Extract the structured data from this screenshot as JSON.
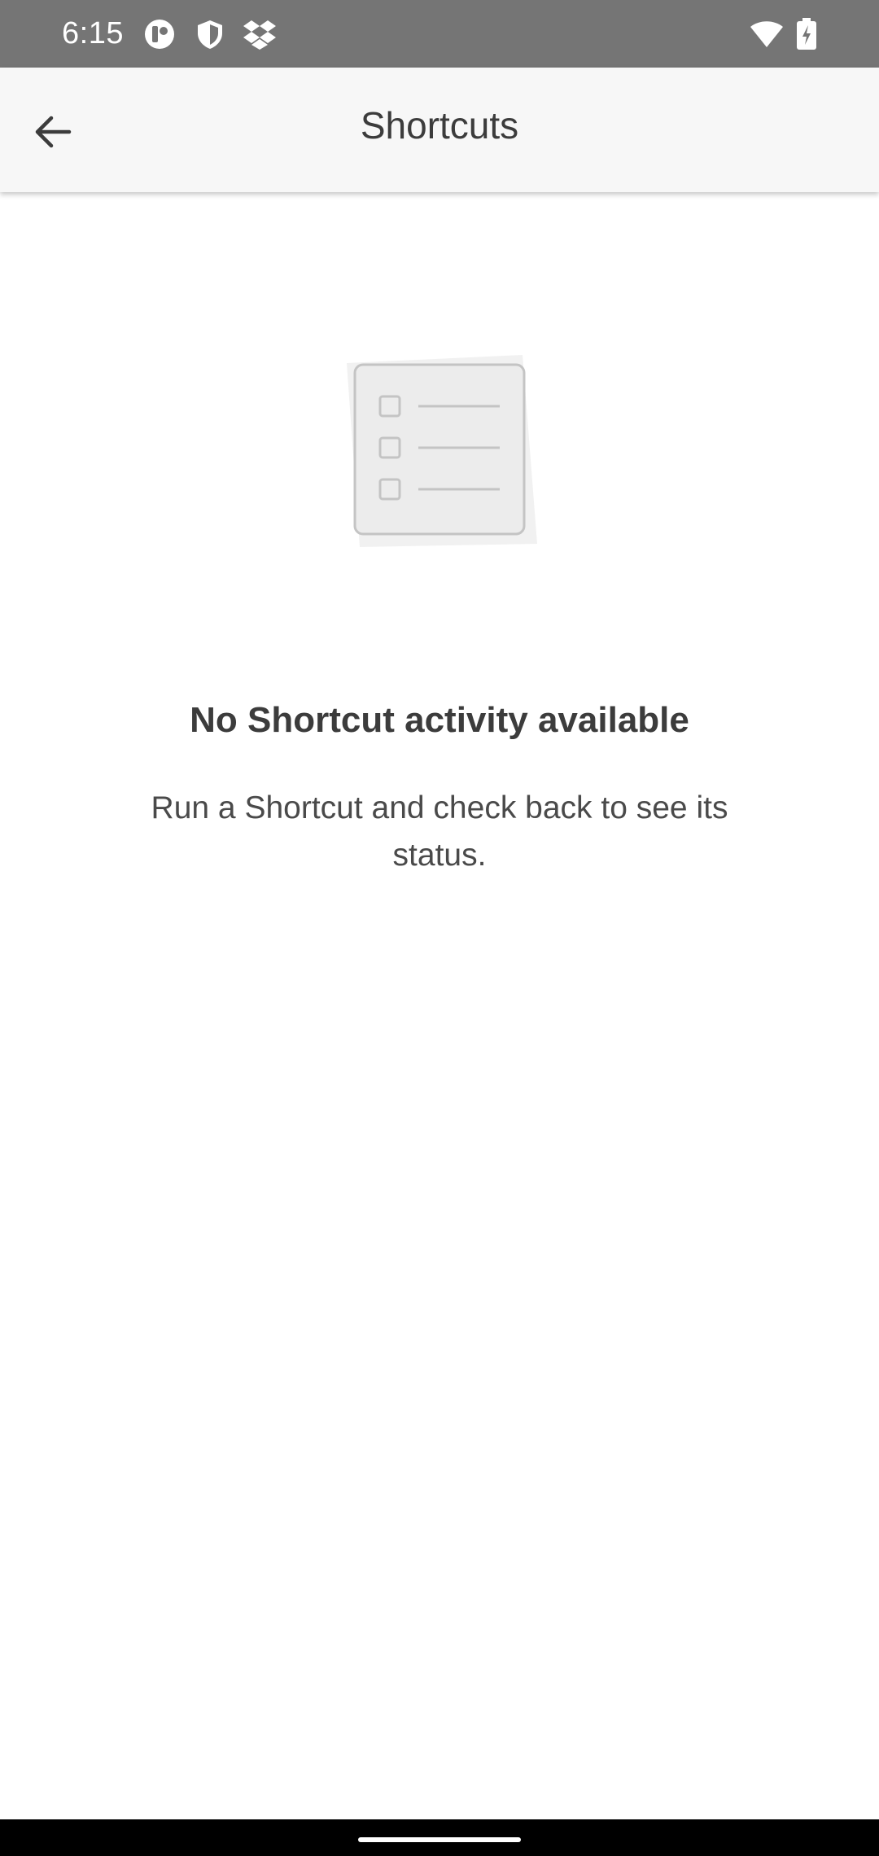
{
  "status_bar": {
    "time": "6:15",
    "notification_icons": [
      "app-notification-icon",
      "shield-icon",
      "dropbox-icon"
    ],
    "system_icons": [
      "wifi-icon",
      "battery-charging-icon"
    ]
  },
  "app_bar": {
    "back_icon": "arrow-back-icon",
    "title": "Shortcuts"
  },
  "empty_state": {
    "illustration_icon": "checklist-document-icon",
    "title": "No Shortcut activity available",
    "description": "Run a Shortcut and check back to see its status."
  },
  "colors": {
    "status_bar_bg": "#757575",
    "app_bar_bg": "#f7f7f7",
    "text_primary": "#3c3c3c",
    "illustration_fill": "#ececec",
    "illustration_stroke": "#c4c4c4"
  }
}
